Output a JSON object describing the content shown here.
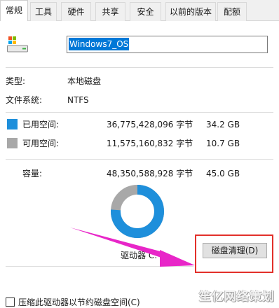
{
  "tabs": [
    {
      "label": "常规",
      "active": true
    },
    {
      "label": "工具",
      "active": false
    },
    {
      "label": "硬件",
      "active": false
    },
    {
      "label": "共享",
      "active": false
    },
    {
      "label": "安全",
      "active": false
    },
    {
      "label": "以前的版本",
      "active": false
    },
    {
      "label": "配额",
      "active": false
    }
  ],
  "drive": {
    "name_value": "Windows7_OS",
    "type_label": "类型:",
    "type_value": "本地磁盘",
    "fs_label": "文件系统:",
    "fs_value": "NTFS"
  },
  "space": {
    "used": {
      "label": "已用空间:",
      "bytes": "36,775,428,096 字节",
      "size": "34.2 GB",
      "color": "#1e8fdb"
    },
    "free": {
      "label": "可用空间:",
      "bytes": "11,575,160,832 字节",
      "size": "10.7 GB",
      "color": "#a8a8a8"
    },
    "capacity": {
      "label": "容量:",
      "bytes": "48,350,588,928 字节",
      "size": "45.0 GB"
    },
    "used_fraction": 0.76
  },
  "drive_letter_label": "驱动器 C:",
  "cleanup_button": "磁盘清理(D)",
  "compress_label": "压缩此驱动器以节约磁盘空间(C)",
  "watermark": "笙亿网络策划",
  "colors": {
    "annotation_red": "#e2302a",
    "arrow_magenta": "#e826c8",
    "selection_blue": "#0078d7"
  }
}
